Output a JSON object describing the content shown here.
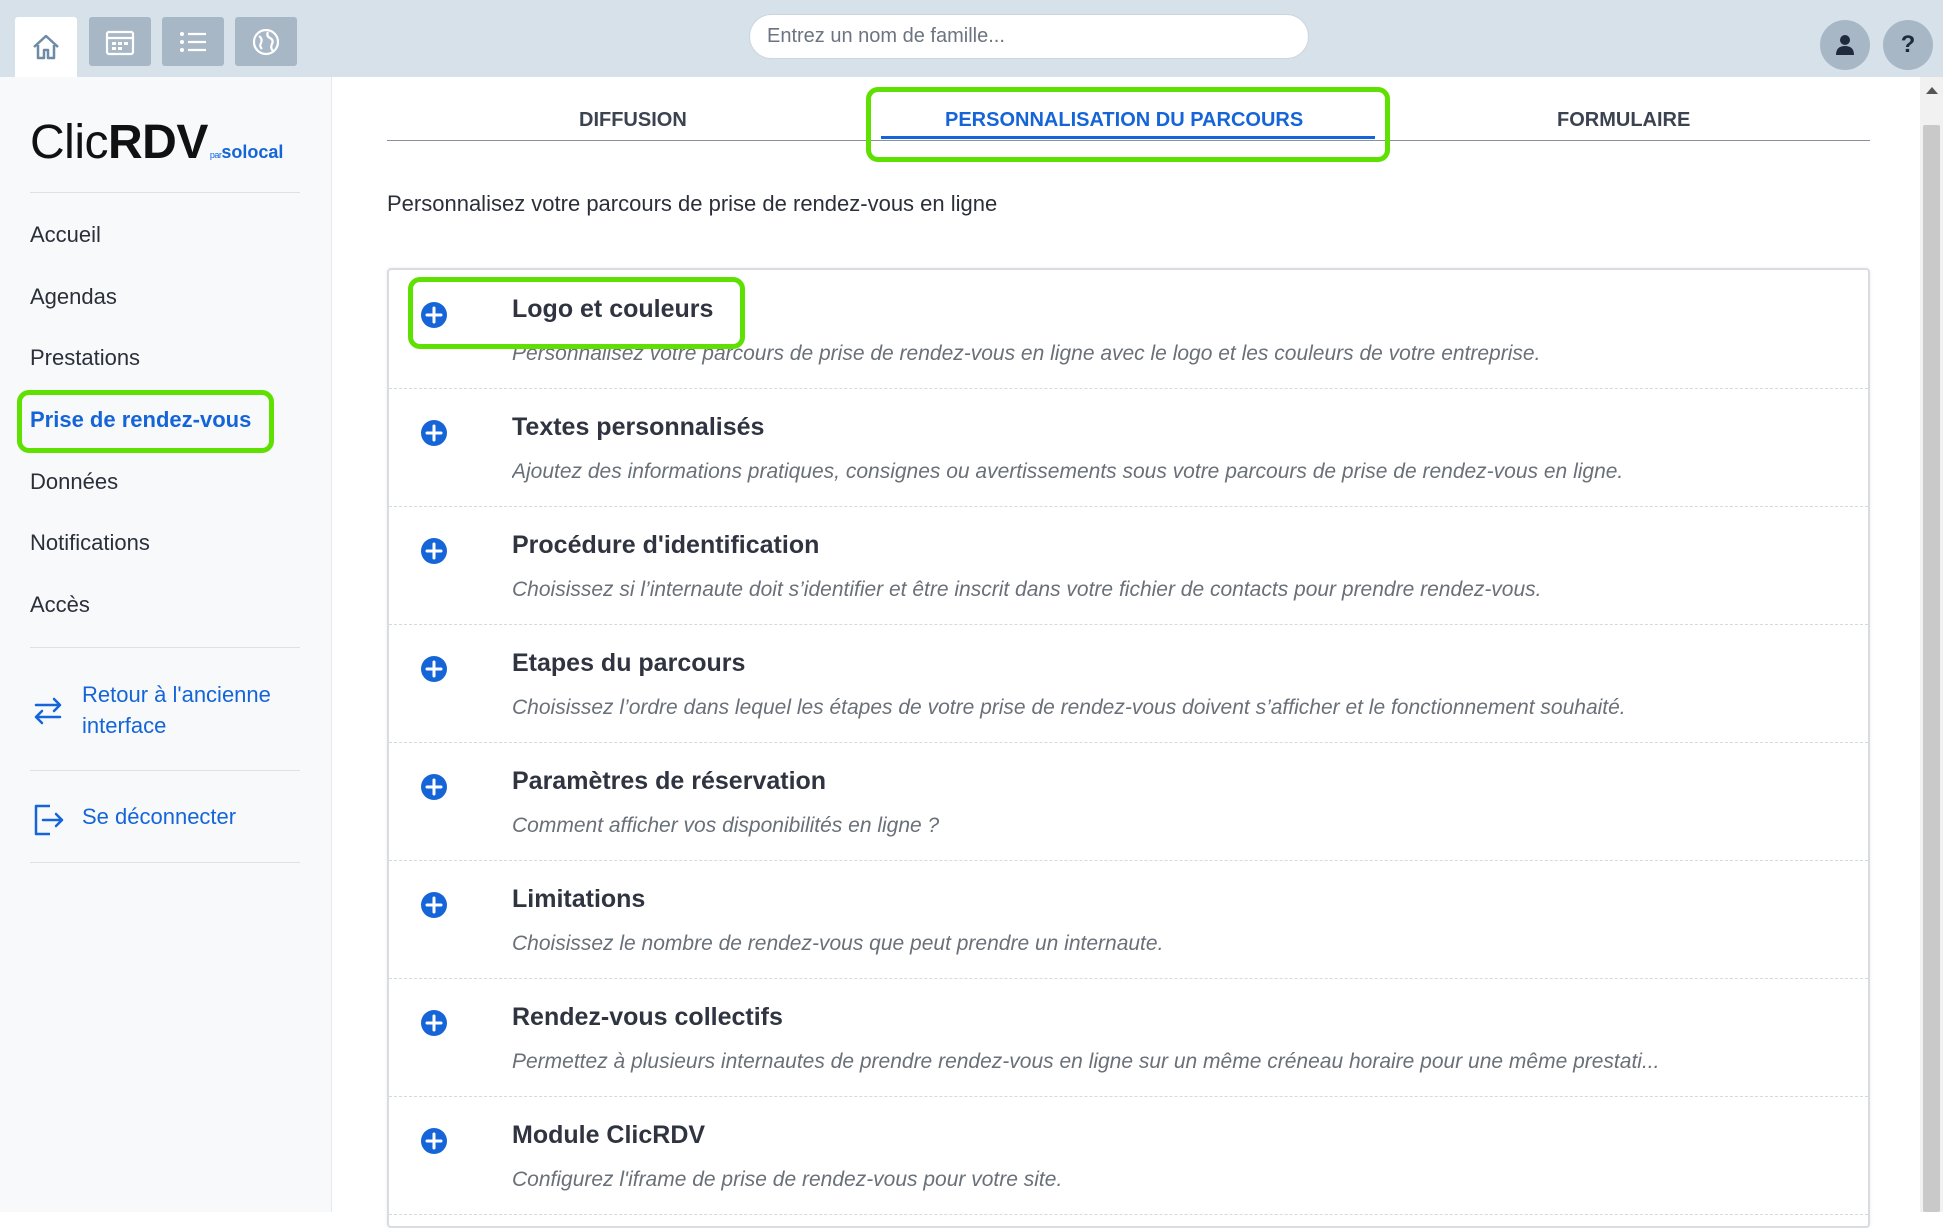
{
  "topbar": {
    "buttons": [
      {
        "icon": "home-icon",
        "active": true
      },
      {
        "icon": "calendar-icon",
        "active": false
      },
      {
        "icon": "list-icon",
        "active": false
      },
      {
        "icon": "globe-icon",
        "active": false
      }
    ],
    "search_placeholder": "Entrez un nom de famille...",
    "help_label": "?"
  },
  "sidebar": {
    "logo": {
      "clic": "Clic",
      "rdv": "RDV",
      "par": "par",
      "solocal": "solocal"
    },
    "items": [
      {
        "label": "Accueil"
      },
      {
        "label": "Agendas"
      },
      {
        "label": "Prestations"
      },
      {
        "label": "Prise de rendez-vous",
        "active": true
      },
      {
        "label": "Données"
      },
      {
        "label": "Notifications"
      },
      {
        "label": "Accès"
      }
    ],
    "back_link": {
      "line1": "Retour à l'ancienne",
      "line2": "interface"
    },
    "logout_label": "Se déconnecter"
  },
  "tabs": [
    {
      "label": "DIFFUSION",
      "active": false
    },
    {
      "label": "PERSONNALISATION DU PARCOURS",
      "active": true
    },
    {
      "label": "FORMULAIRE",
      "active": false
    }
  ],
  "intro": "Personnalisez votre parcours de prise de rendez-vous en ligne",
  "sections": [
    {
      "title": "Logo et couleurs",
      "description": "Personnalisez votre parcours de prise de rendez-vous en ligne avec le logo et les couleurs de votre entreprise."
    },
    {
      "title": "Textes personnalisés",
      "description": "Ajoutez des informations pratiques, consignes ou avertissements sous votre parcours de prise de rendez-vous en ligne."
    },
    {
      "title": "Procédure d'identification",
      "description": "Choisissez si l’internaute doit s’identifier et être inscrit dans votre fichier de contacts pour prendre rendez-vous."
    },
    {
      "title": "Etapes du parcours",
      "description": "Choisissez l’ordre dans lequel les étapes de votre prise de rendez-vous doivent s’afficher et le fonctionnement souhaité."
    },
    {
      "title": "Paramètres de réservation",
      "description": "Comment afficher vos disponibilités en ligne ?"
    },
    {
      "title": "Limitations",
      "description": "Choisissez le nombre de rendez-vous que peut prendre un internaute."
    },
    {
      "title": "Rendez-vous collectifs",
      "description": "Permettez à plusieurs internautes de prendre rendez-vous en ligne sur un même créneau horaire pour une même prestati..."
    },
    {
      "title": "Module ClicRDV",
      "description": "Configurez l'iframe de prise de rendez-vous pour votre site."
    }
  ],
  "colors": {
    "accent": "#1565d8",
    "highlight": "#5ee000",
    "topbar": "#d6e1ea"
  }
}
